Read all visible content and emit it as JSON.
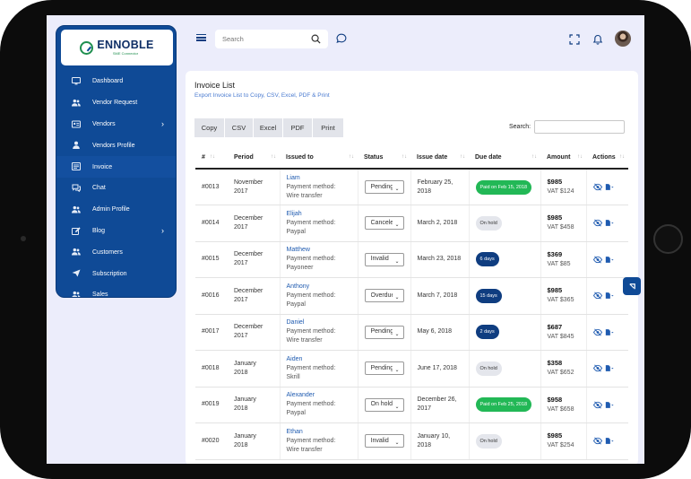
{
  "brand": {
    "name": "ENNOBLE",
    "tagline": "SME Connector"
  },
  "sidebar": {
    "items": [
      {
        "label": "Dashboard",
        "icon": "monitor-icon"
      },
      {
        "label": "Vendor Request",
        "icon": "users-icon"
      },
      {
        "label": "Vendors",
        "icon": "id-card-icon",
        "chevron": "›"
      },
      {
        "label": "Vendors Profile",
        "icon": "user-icon"
      },
      {
        "label": "Invoice",
        "icon": "invoice-icon"
      },
      {
        "label": "Chat",
        "icon": "chat-icon"
      },
      {
        "label": "Admin Profile",
        "icon": "users-icon"
      },
      {
        "label": "Blog",
        "icon": "edit-icon",
        "chevron": "›"
      },
      {
        "label": "Customers",
        "icon": "users-icon"
      },
      {
        "label": "Subscription",
        "icon": "send-icon"
      },
      {
        "label": "Sales",
        "icon": "users-icon"
      }
    ]
  },
  "topbar": {
    "search_placeholder": "Search"
  },
  "invoice": {
    "title": "Invoice List",
    "subtitle": "Export Invoice List to Copy, CSV, Excel, PDF & Print",
    "buttons": [
      "Copy",
      "CSV",
      "Excel",
      "PDF",
      "Print"
    ],
    "search_label": "Search:",
    "columns": [
      "#",
      "Period",
      "Issued to",
      "Status",
      "Issue date",
      "Due date",
      "Amount",
      "Actions"
    ],
    "rows": [
      {
        "id": "#0013",
        "period1": "November",
        "period2": "2017",
        "name": "Liam",
        "pm1": "Payment method:",
        "pm2": "Wire transfer",
        "status": "Pending",
        "issue1": "February 25,",
        "issue2": "2018",
        "due": "Paid on Feb 15, 2018",
        "due_style": "green",
        "amount": "$985",
        "vat": "VAT $124"
      },
      {
        "id": "#0014",
        "period1": "December",
        "period2": "2017",
        "name": "Elijah",
        "pm1": "Payment method:",
        "pm2": "Paypal",
        "status": "Canceled",
        "issue1": "March 2, 2018",
        "issue2": "",
        "due": "On hold",
        "due_style": "gray",
        "amount": "$985",
        "vat": "VAT $458"
      },
      {
        "id": "#0015",
        "period1": "December",
        "period2": "2017",
        "name": "Matthew",
        "pm1": "Payment method:",
        "pm2": "Payoneer",
        "status": "Invalid",
        "issue1": "March 23, 2018",
        "issue2": "",
        "due": "6 days",
        "due_style": "navy",
        "amount": "$369",
        "vat": "VAT $85"
      },
      {
        "id": "#0016",
        "period1": "December",
        "period2": "2017",
        "name": "Anthony",
        "pm1": "Payment method:",
        "pm2": "Paypal",
        "status": "Overdue",
        "issue1": "March 7, 2018",
        "issue2": "",
        "due": "15 days",
        "due_style": "navy",
        "amount": "$985",
        "vat": "VAT $365"
      },
      {
        "id": "#0017",
        "period1": "December",
        "period2": "2017",
        "name": "Daniel",
        "pm1": "Payment method:",
        "pm2": "Wire transfer",
        "status": "Pending",
        "issue1": "May 6, 2018",
        "issue2": "",
        "due": "2 days",
        "due_style": "navy",
        "amount": "$687",
        "vat": "VAT $845"
      },
      {
        "id": "#0018",
        "period1": "January",
        "period2": "2018",
        "name": "Aiden",
        "pm1": "Payment method:",
        "pm2": "Skrill",
        "status": "Pending",
        "issue1": "June 17, 2018",
        "issue2": "",
        "due": "On hold",
        "due_style": "gray",
        "amount": "$358",
        "vat": "VAT $652"
      },
      {
        "id": "#0019",
        "period1": "January",
        "period2": "2018",
        "name": "Alexander",
        "pm1": "Payment method:",
        "pm2": "Paypal",
        "status": "On hold",
        "issue1": "December 26,",
        "issue2": "2017",
        "due": "Paid on Feb 25, 2018",
        "due_style": "green",
        "amount": "$958",
        "vat": "VAT $658"
      },
      {
        "id": "#0020",
        "period1": "January",
        "period2": "2018",
        "name": "Ethan",
        "pm1": "Payment method:",
        "pm2": "Wire transfer",
        "status": "Invalid",
        "issue1": "January 10,",
        "issue2": "2018",
        "due": "On hold",
        "due_style": "gray",
        "amount": "$985",
        "vat": "VAT $254"
      }
    ]
  },
  "colors": {
    "sidebar": "#0f4a96",
    "accent": "#1f5bb0",
    "success": "#22b856",
    "navy": "#0f3d80"
  }
}
